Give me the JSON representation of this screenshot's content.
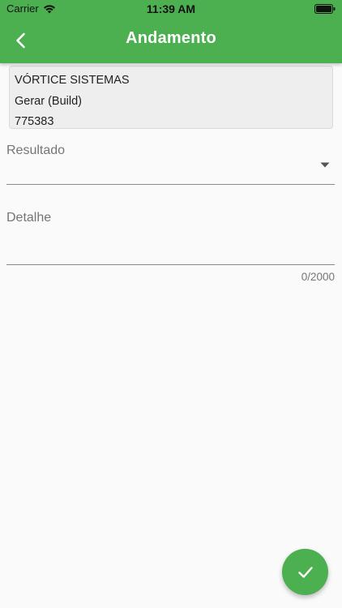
{
  "status_bar": {
    "carrier": "Carrier",
    "time": "11:39 AM"
  },
  "header": {
    "title": "Andamento",
    "back_icon": "chevron-left-icon"
  },
  "info_card": {
    "company": "VÓRTICE SISTEMAS",
    "activity": "Gerar (Build)",
    "code": "775383"
  },
  "form": {
    "resultado_label": "Resultado",
    "detalhe_label": "Detalhe",
    "detalhe_counter": "0/2000"
  },
  "fab": {
    "icon": "check-icon"
  },
  "colors": {
    "primary": "#4caf50",
    "background": "#fafafa",
    "card": "#eeeeee",
    "label": "#757575"
  }
}
